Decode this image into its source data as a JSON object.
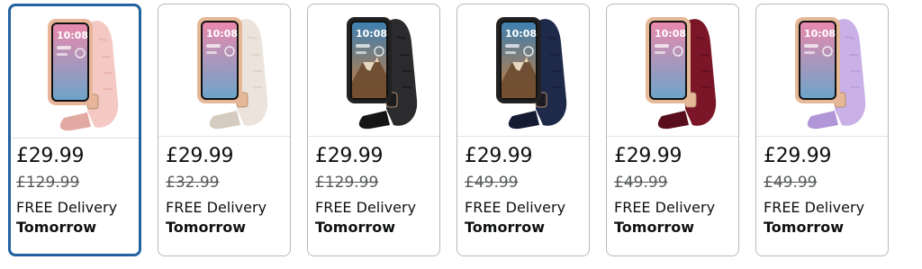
{
  "products": [
    {
      "price": "£29.99",
      "list_price": "£129.99",
      "delivery": "FREE Delivery",
      "delivery_day": "Tomorrow",
      "strap_color": "#f4c9c3",
      "strap_dark": "#e2a9a2",
      "case_color": "#e8b59a",
      "screen": "pink",
      "selected": true
    },
    {
      "price": "£29.99",
      "list_price": "£32.99",
      "delivery": "FREE Delivery",
      "delivery_day": "Tomorrow",
      "strap_color": "#ece4dc",
      "strap_dark": "#d6cbc0",
      "case_color": "#e5b898",
      "screen": "pink",
      "selected": false
    },
    {
      "price": "£29.99",
      "list_price": "£129.99",
      "delivery": "FREE Delivery",
      "delivery_day": "Tomorrow",
      "strap_color": "#2b2b2d",
      "strap_dark": "#151516",
      "case_color": "#1c1c1e",
      "screen": "mountain",
      "selected": false
    },
    {
      "price": "£29.99",
      "list_price": "£49.99",
      "delivery": "FREE Delivery",
      "delivery_day": "Tomorrow",
      "strap_color": "#1f2a4a",
      "strap_dark": "#141b33",
      "case_color": "#1c1c22",
      "screen": "mountain",
      "selected": false
    },
    {
      "price": "£29.99",
      "list_price": "£49.99",
      "delivery": "FREE Delivery",
      "delivery_day": "Tomorrow",
      "strap_color": "#7a1628",
      "strap_dark": "#5a0d1c",
      "case_color": "#e5b898",
      "screen": "pink",
      "selected": false
    },
    {
      "price": "£29.99",
      "list_price": "£49.99",
      "delivery": "FREE Delivery",
      "delivery_day": "Tomorrow",
      "strap_color": "#c9b0e6",
      "strap_dark": "#b096d6",
      "case_color": "#e5b898",
      "screen": "pink",
      "selected": false
    }
  ],
  "watch_face": {
    "time": "10:08"
  }
}
